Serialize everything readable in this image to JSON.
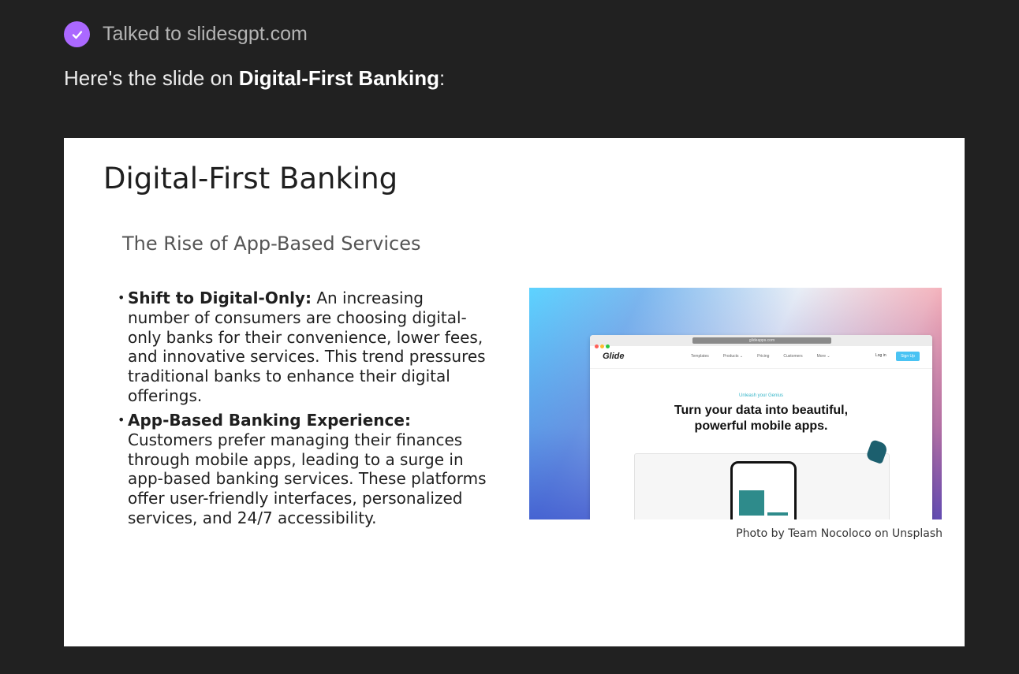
{
  "status": {
    "text": "Talked to slidesgpt.com",
    "icon": "check-circle-icon",
    "accent": "#ab68ff"
  },
  "intro": {
    "prefix": "Here's the slide on ",
    "bold": "Digital-First Banking",
    "suffix": ":"
  },
  "slide": {
    "title": "Digital-First Banking",
    "subtitle": "The Rise of App-Based Services",
    "bullets": [
      {
        "lead": "Shift to Digital-Only:",
        "text": " An increasing number of consumers are choosing digital-only banks for their convenience, lower fees, and innovative services. This trend pressures traditional banks to enhance their digital offerings."
      },
      {
        "lead": "App-Based Banking Experience:",
        "text": " Customers prefer managing their finances through mobile apps, leading to a surge in app-based banking services. These platforms offer user-friendly interfaces, personalized services, and 24/7 accessibility."
      }
    ],
    "photo": {
      "logo": "Glide",
      "nav": [
        "Templates",
        "Products ⌄",
        "Pricing",
        "Customers",
        "More ⌄"
      ],
      "login": "Log in",
      "signup": "Sign Up",
      "url": "glideapps.com",
      "kicker": "Unleash your Genius",
      "headline_line1": "Turn your data into beautiful,",
      "headline_line2": "powerful mobile apps.",
      "caption": "Photo by Team Nocoloco on Unsplash"
    }
  }
}
